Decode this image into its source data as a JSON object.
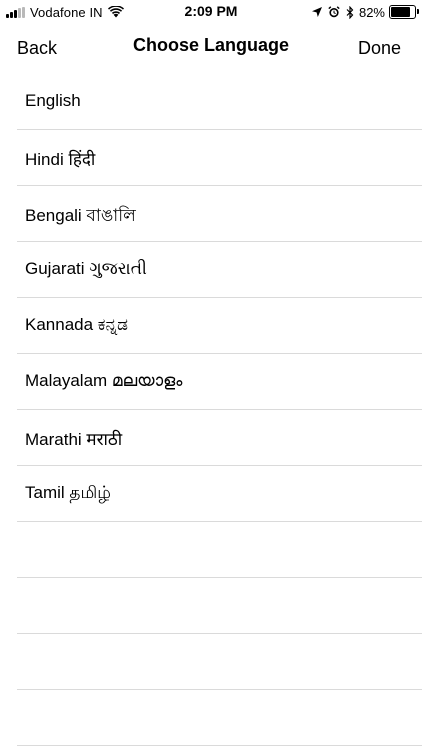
{
  "status_bar": {
    "carrier": "Vodafone IN",
    "time": "2:09 PM",
    "battery_percent": "82%",
    "battery_level": 0.82,
    "signal_bars_filled": 3,
    "signal_bars_total": 5,
    "icons": [
      "signal-icon",
      "wifi-icon",
      "location-arrow-icon",
      "alarm-icon",
      "bluetooth-icon",
      "battery-icon"
    ]
  },
  "nav": {
    "back_label": "Back",
    "title": "Choose Language",
    "done_label": "Done"
  },
  "languages": [
    "English",
    "Hindi हिंदी",
    "Bengali বাঙালি",
    "Gujarati ગુજરાતી",
    "Kannada ಕನ್ನಡ",
    "Malayalam മലയാളം",
    "Marathi मराठी",
    "Tamil தமிழ்"
  ],
  "empty_rows": 4,
  "colors": {
    "separator": "#dadada",
    "text": "#000000",
    "background": "#ffffff"
  }
}
